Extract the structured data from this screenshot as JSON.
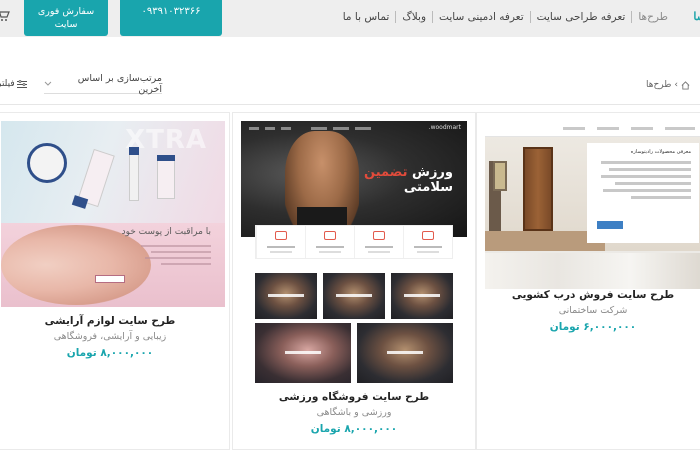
{
  "header": {
    "logo": "سا",
    "nav": [
      {
        "label": "طرح‌ها"
      },
      {
        "label": "تعرفه طراحی سایت"
      },
      {
        "label": "تعرفه ادمینی سایت"
      },
      {
        "label": "وبلاگ"
      },
      {
        "label": "تماس با ما"
      }
    ],
    "phone": "۰۹۳۹۱۰۳۲۳۶۶",
    "order_line1": "سفارش فوری",
    "order_line2": "سایت"
  },
  "toolbar": {
    "breadcrumb_home_icon": "home-icon",
    "breadcrumb": "طرح‌ها",
    "sort_label": "مرتب‌سازی بر اساس آخرین",
    "filter_label": "فیلتر"
  },
  "products": [
    {
      "title": "طرح سایت فروش درب کشویی",
      "subtitle": "شرکت ساختمانی",
      "price": "۶,۰۰۰,۰۰۰ تومان",
      "preview": {
        "menu_title": "معرفی محصولات رادیتوسازه"
      }
    },
    {
      "title": "طرح سایت فروشگاه ورزشی",
      "subtitle": "ورزشی و باشگاهی",
      "price": "۸,۰۰۰,۰۰۰ تومان",
      "preview": {
        "brand": "woodmart.",
        "headline_1": "ورزش",
        "headline_2": "تضمین",
        "headline_3": "سلامتی"
      }
    },
    {
      "title": "طرح سایت لوازم آرایشی",
      "subtitle": "زیبایی و آرایشی، فروشگاهی",
      "price": "۸,۰۰۰,۰۰۰ تومان",
      "preview": {
        "big_text": "XTRA",
        "slogan": "با مراقبت از پوست خود"
      }
    }
  ],
  "colors": {
    "accent": "#19a5ad",
    "header_bg": "#eeeeee"
  }
}
